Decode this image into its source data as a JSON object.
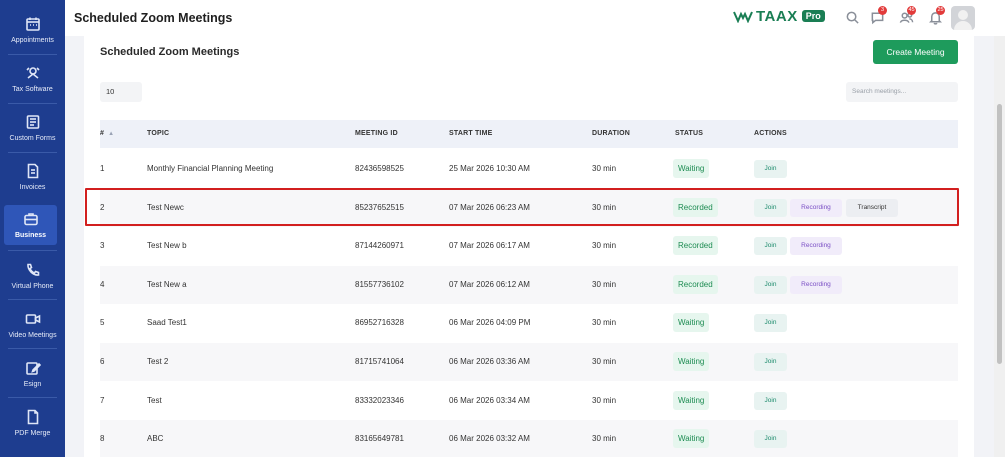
{
  "sidebar": {
    "items": [
      {
        "label": "Appointments",
        "icon": "calendar-icon"
      },
      {
        "label": "Tax Software",
        "icon": "tax-software-icon"
      },
      {
        "label": "Custom Forms",
        "icon": "form-icon"
      },
      {
        "label": "Invoices",
        "icon": "invoice-icon"
      },
      {
        "label": "Business",
        "icon": "briefcase-icon",
        "active": true
      },
      {
        "label": "Virtual Phone",
        "icon": "phone-icon"
      },
      {
        "label": "Video Meetings",
        "icon": "video-icon"
      },
      {
        "label": "Esign",
        "icon": "pen-icon"
      },
      {
        "label": "PDF Merge",
        "icon": "pdf-icon"
      }
    ]
  },
  "header": {
    "title": "Scheduled Zoom Meetings",
    "logo_text": "TAAX",
    "logo_badge": "Pro",
    "badges": {
      "chat": "3",
      "contacts": "45",
      "notifications": "25"
    }
  },
  "main": {
    "title": "Scheduled Zoom Meetings",
    "create_label": "Create Meeting",
    "page_size": "10",
    "search_placeholder": "Search meetings...",
    "columns": [
      "#",
      "TOPIC",
      "MEETING ID",
      "START TIME",
      "DURATION",
      "STATUS",
      "ACTIONS"
    ],
    "rows": [
      {
        "num": "1",
        "topic": "Monthly Financial Planning Meeting",
        "id": "82436598525",
        "start": "25 Mar 2026 10:30 AM",
        "duration": "30 min",
        "status": "Waiting",
        "actions": [
          "Join"
        ]
      },
      {
        "num": "2",
        "topic": "Test Newc",
        "id": "85237652515",
        "start": "07 Mar 2026 06:23 AM",
        "duration": "30 min",
        "status": "Recorded",
        "actions": [
          "Join",
          "Recording",
          "Transcript"
        ]
      },
      {
        "num": "3",
        "topic": "Test New b",
        "id": "87144260971",
        "start": "07 Mar 2026 06:17 AM",
        "duration": "30 min",
        "status": "Recorded",
        "actions": [
          "Join",
          "Recording"
        ]
      },
      {
        "num": "4",
        "topic": "Test New a",
        "id": "81557736102",
        "start": "07 Mar 2026 06:12 AM",
        "duration": "30 min",
        "status": "Recorded",
        "actions": [
          "Join",
          "Recording"
        ]
      },
      {
        "num": "5",
        "topic": "Saad Test1",
        "id": "86952716328",
        "start": "06 Mar 2026 04:09 PM",
        "duration": "30 min",
        "status": "Waiting",
        "actions": [
          "Join"
        ]
      },
      {
        "num": "6",
        "topic": "Test 2",
        "id": "81715741064",
        "start": "06 Mar 2026 03:36 AM",
        "duration": "30 min",
        "status": "Waiting",
        "actions": [
          "Join"
        ]
      },
      {
        "num": "7",
        "topic": "Test",
        "id": "83332023346",
        "start": "06 Mar 2026 03:34 AM",
        "duration": "30 min",
        "status": "Waiting",
        "actions": [
          "Join"
        ]
      },
      {
        "num": "8",
        "topic": "ABC",
        "id": "83165649781",
        "start": "06 Mar 2026 03:32 AM",
        "duration": "30 min",
        "status": "Waiting",
        "actions": [
          "Join"
        ]
      }
    ]
  },
  "colors": {
    "sidebar": "#1e3d8f",
    "accent_green": "#1e9b5c",
    "highlight": "#d21f1f"
  }
}
